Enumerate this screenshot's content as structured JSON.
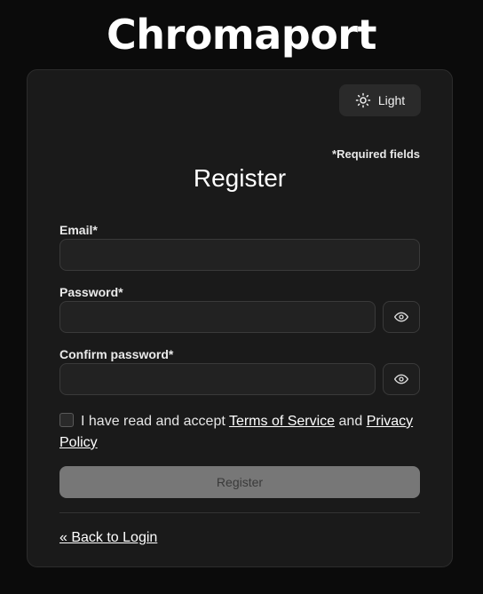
{
  "brand": {
    "name": "Chromaport"
  },
  "theme_toggle": {
    "label": "Light",
    "icon": "sun-icon"
  },
  "form": {
    "required_note": "*Required fields",
    "title": "Register",
    "email": {
      "label": "Email*",
      "value": "",
      "placeholder": ""
    },
    "password": {
      "label": "Password*",
      "value": "",
      "placeholder": "",
      "toggle_icon": "eye-icon"
    },
    "confirm_password": {
      "label": "Confirm password*",
      "value": "",
      "placeholder": "",
      "toggle_icon": "eye-icon"
    },
    "terms": {
      "checked": false,
      "prefix": "I have read and accept",
      "tos_link": "Terms of Service",
      "conjunction": "and",
      "privacy_link": "Privacy Policy"
    },
    "submit_label": "Register",
    "back_link": "« Back to Login"
  },
  "colors": {
    "background": "#0b0b0b",
    "card": "#1a1a1a",
    "submit_disabled": "#777777"
  }
}
